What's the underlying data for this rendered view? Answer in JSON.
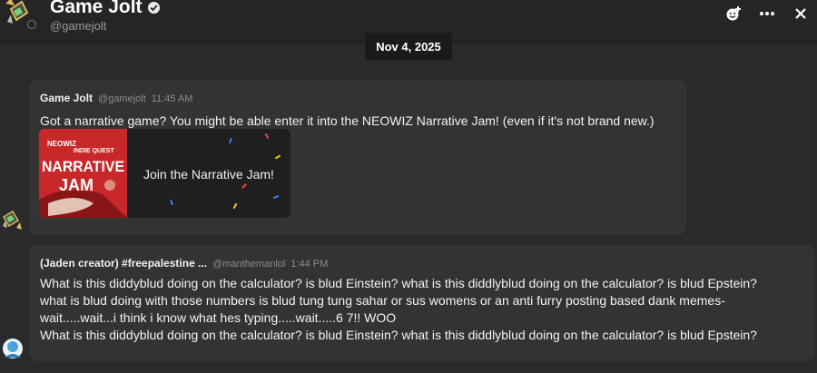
{
  "header": {
    "title": "Game Jolt",
    "handle": "@gamejolt",
    "actions": [
      "add-emoji-icon",
      "more-icon",
      "close-icon"
    ]
  },
  "date_divider": "Nov 4, 2025",
  "messages": [
    {
      "author": "Game Jolt",
      "handle": "@gamejolt",
      "time": "11:45 AM",
      "text": "Got a narrative game? You might be able enter it into the NEOWIZ Narrative Jam! (even if it's not brand new.)",
      "card": {
        "thumb_lines": [
          "NEOWIZ",
          "INDIE QUEST",
          "NARRATIVE",
          "JAM"
        ],
        "cta": "Join the Narrative Jam!"
      }
    },
    {
      "author": "(Jaden creator) #freepalestine ...",
      "handle": "@manthemanlol",
      "time": "1:44 PM",
      "lines": [
        "What is this diddyblud doing on the calculator? is blud Einstein? what is this diddlyblud doing on the calculator? is blud Epstein?",
        "what is blud doing with those numbers is blud tung tung sahar or sus womens or an anti furry posting based dank memes-",
        "wait.....wait...i think i know what hes typing.....wait.....6 7!! WOO",
        "What is this diddyblud doing on the calculator? is blud Einstein? what is this diddlyblud doing on the calculator? is blud Epstein?"
      ]
    }
  ],
  "colors": {
    "background": "#2a2a2a",
    "bubble": "#333333",
    "card": "#1f1f1f",
    "thumb_red": "#c8282a"
  }
}
